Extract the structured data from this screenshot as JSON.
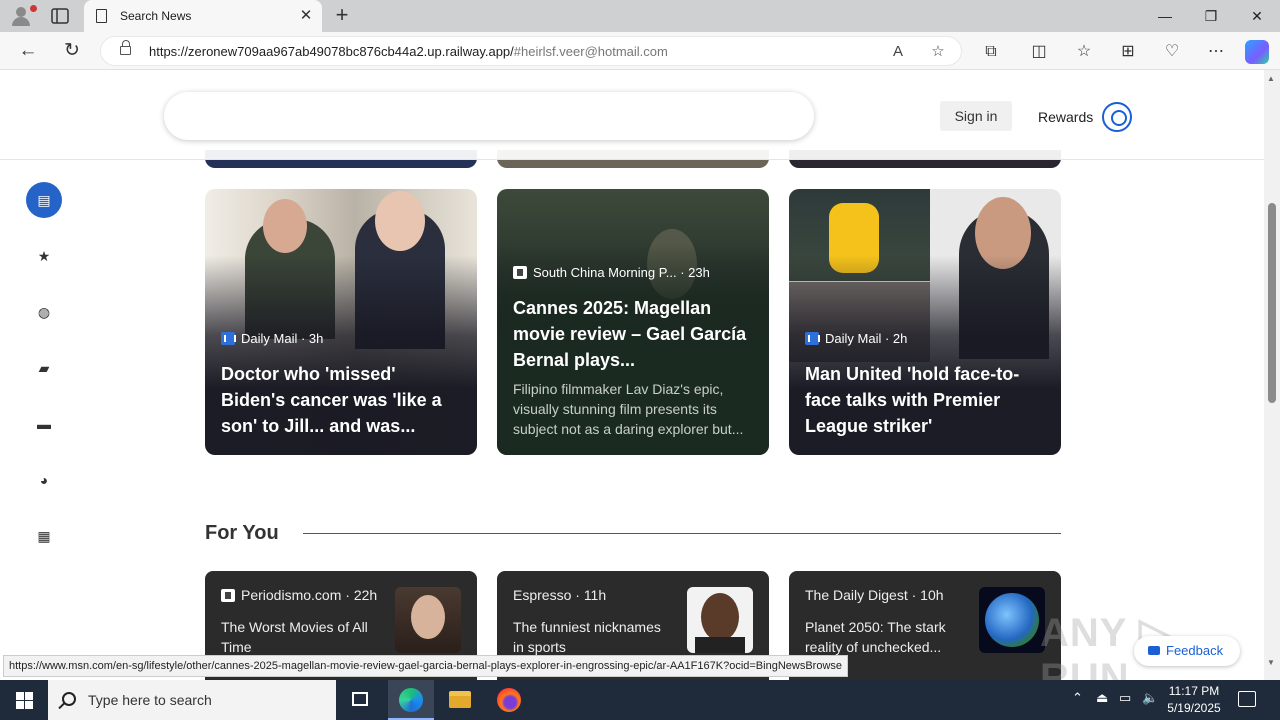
{
  "browser": {
    "tab_title": "Search News",
    "url_main": "https://zeronew709aa967ab49078bc876cb44a2.up.railway.app/",
    "url_hash": "#heirlsf.veer@hotmail.com"
  },
  "header": {
    "sign_in": "Sign in",
    "rewards": "Rewards"
  },
  "rail": {
    "icons": [
      "news-icon",
      "star-icon",
      "globe-icon",
      "entertainment-icon",
      "briefcase-icon",
      "sports-icon",
      "books-icon"
    ]
  },
  "cards": [
    {
      "source": "Daily Mail",
      "age": "3h",
      "headline": "Doctor who 'missed' Biden's cancer was 'like a son' to Jill... and was..."
    },
    {
      "source": "South China Morning P...",
      "age": "23h",
      "headline": "Cannes 2025: Magellan movie review – Gael García Bernal plays...",
      "snippet": "Filipino filmmaker Lav Diaz's epic, visually stunning film presents its subject not as a daring explorer but..."
    },
    {
      "source": "Daily Mail",
      "age": "2h",
      "headline": "Man United 'hold face-to-face talks with Premier League striker'"
    }
  ],
  "for_you": {
    "heading": "For You",
    "items": [
      {
        "source": "Periodismo.com",
        "age": "22h",
        "title": "The Worst Movies of All Time"
      },
      {
        "source": "Espresso",
        "age": "11h",
        "title": "The funniest nicknames in sports"
      },
      {
        "source": "The Daily Digest",
        "age": "10h",
        "title": "Planet 2050: The stark reality of unchecked..."
      }
    ]
  },
  "feedback": "Feedback",
  "watermark": "ANY.RUN",
  "status_url": "https://www.msn.com/en-sg/lifestyle/other/cannes-2025-magellan-movie-review-gael-garcia-bernal-plays-explorer-in-engrossing-epic/ar-AA1F167K?ocid=BingNewsBrowse",
  "taskbar": {
    "search_placeholder": "Type here to search",
    "time": "11:17 PM",
    "date": "5/19/2025"
  },
  "colors": {
    "accent": "#2563c9",
    "taskbar": "#1f2a3a",
    "card_dark": "#1c1c26"
  }
}
